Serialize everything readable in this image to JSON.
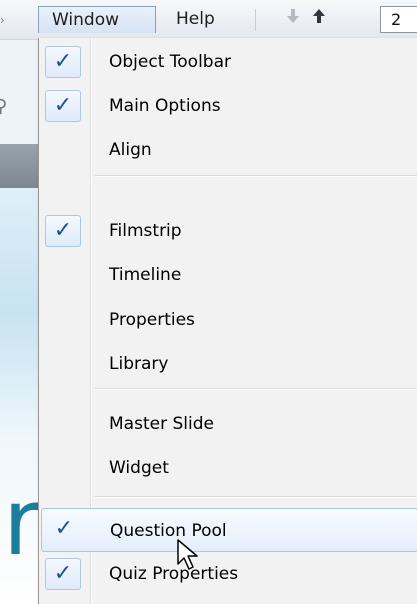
{
  "menubar": {
    "items": [
      {
        "label": "Window"
      },
      {
        "label": "Help"
      }
    ],
    "page_number": "2",
    "icons": {
      "left_glyph": "partial-arrow-icon",
      "down": "arrow-down-icon",
      "up": "arrow-up-icon"
    }
  },
  "window_menu": {
    "check_glyph": "✓",
    "items": [
      {
        "label": "Object Toolbar",
        "checked": true
      },
      {
        "label": "Main Options",
        "checked": true
      },
      {
        "label": "Align",
        "checked": false
      },
      {
        "label": "Filmstrip",
        "checked": true
      },
      {
        "label": "Timeline",
        "checked": false
      },
      {
        "label": "Properties",
        "checked": false
      },
      {
        "label": "Library",
        "checked": false
      },
      {
        "label": "Master Slide",
        "checked": false
      },
      {
        "label": "Widget",
        "checked": false
      },
      {
        "label": "Question Pool",
        "checked": true,
        "hovered": true
      },
      {
        "label": "Quiz Properties",
        "checked": true
      }
    ]
  },
  "colors": {
    "accent": "#1f4f9c",
    "highlight_border": "#a9c5e8",
    "menu_bg": "#f2f2f2"
  }
}
